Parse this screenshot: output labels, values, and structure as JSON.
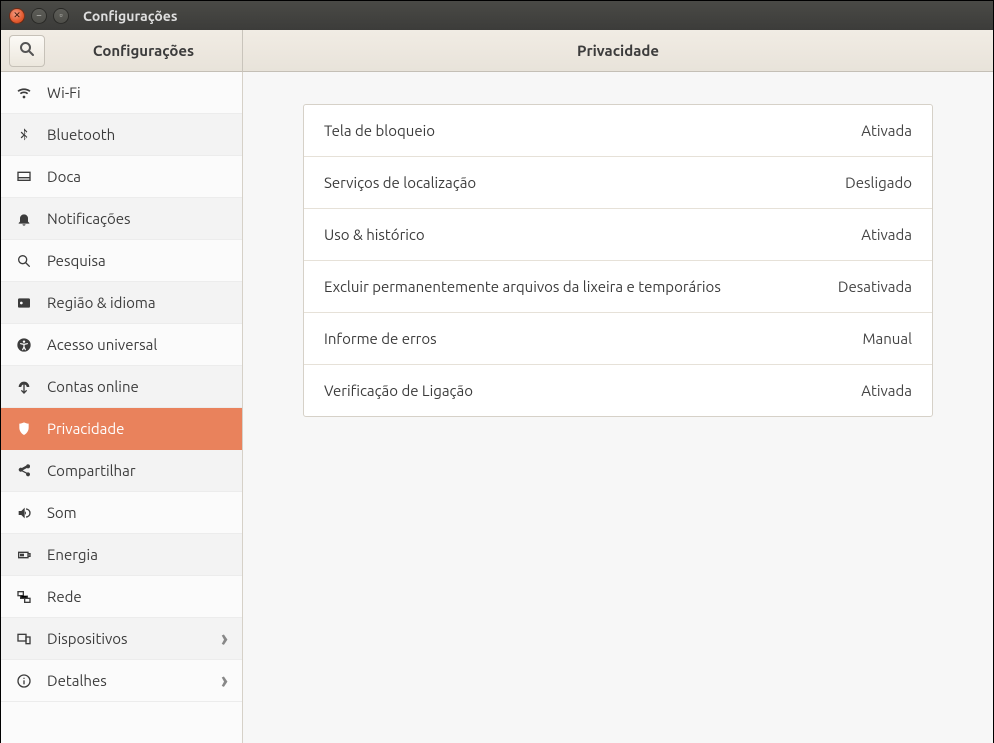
{
  "window_title": "Configurações",
  "sidebar_header": "Configurações",
  "content_header": "Privacidade",
  "sidebar": {
    "items": [
      {
        "id": "wifi",
        "label": "Wi-Fi",
        "chevron": false
      },
      {
        "id": "bluetooth",
        "label": "Bluetooth",
        "chevron": false
      },
      {
        "id": "dock",
        "label": "Doca",
        "chevron": false
      },
      {
        "id": "notifications",
        "label": "Notificações",
        "chevron": false
      },
      {
        "id": "search",
        "label": "Pesquisa",
        "chevron": false
      },
      {
        "id": "region",
        "label": "Região & idioma",
        "chevron": false
      },
      {
        "id": "universal",
        "label": "Acesso universal",
        "chevron": false
      },
      {
        "id": "online",
        "label": "Contas online",
        "chevron": false
      },
      {
        "id": "privacy",
        "label": "Privacidade",
        "chevron": false,
        "selected": true
      },
      {
        "id": "sharing",
        "label": "Compartilhar",
        "chevron": false
      },
      {
        "id": "sound",
        "label": "Som",
        "chevron": false
      },
      {
        "id": "power",
        "label": "Energia",
        "chevron": false
      },
      {
        "id": "network",
        "label": "Rede",
        "chevron": false
      },
      {
        "id": "devices",
        "label": "Dispositivos",
        "chevron": true
      },
      {
        "id": "details",
        "label": "Detalhes",
        "chevron": true
      }
    ]
  },
  "privacy_rows": [
    {
      "name": "Tela de bloqueio",
      "value": "Ativada"
    },
    {
      "name": "Serviços de localização",
      "value": "Desligado"
    },
    {
      "name": "Uso & histórico",
      "value": "Ativada"
    },
    {
      "name": "Excluir permanentemente arquivos da lixeira e temporários",
      "value": "Desativada"
    },
    {
      "name": "Informe de erros",
      "value": "Manual"
    },
    {
      "name": "Verificação de Ligação",
      "value": "Ativada"
    }
  ]
}
